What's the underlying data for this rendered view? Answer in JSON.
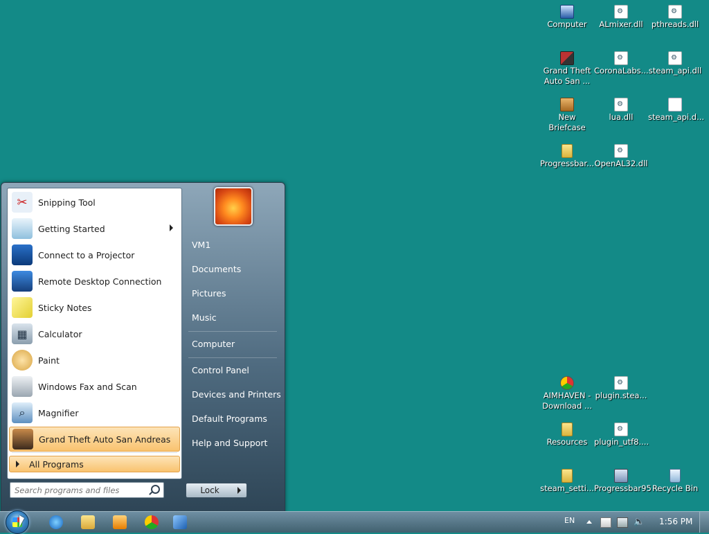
{
  "desktop": {
    "icons": [
      {
        "label": "Computer",
        "icon": "computer-icon"
      },
      {
        "label": "ALmixer.dll",
        "icon": "dll-file-icon"
      },
      {
        "label": "pthreads.dll",
        "icon": "dll-file-icon"
      },
      {
        "label": "Grand Theft Auto San ...",
        "icon": "gta-game-icon"
      },
      {
        "label": "CoronaLabs...",
        "icon": "dll-file-icon"
      },
      {
        "label": "steam_api.dll",
        "icon": "dll-file-icon"
      },
      {
        "label": "New Briefcase",
        "icon": "briefcase-icon"
      },
      {
        "label": "lua.dll",
        "icon": "dll-file-icon"
      },
      {
        "label": "steam_api.d...",
        "icon": "blank-file-icon"
      },
      {
        "label": "Progressbar...",
        "icon": "zip-folder-icon"
      },
      {
        "label": "OpenAL32.dll",
        "icon": "dll-file-icon"
      },
      {
        "label": "AIMHAVEN - Download ...",
        "icon": "chrome-shortcut-icon"
      },
      {
        "label": "plugin.stea...",
        "icon": "dll-file-icon"
      },
      {
        "label": "Resources",
        "icon": "zip-folder-icon"
      },
      {
        "label": "plugin_utf8....",
        "icon": "dll-file-icon"
      },
      {
        "label": "steam_setti...",
        "icon": "zip-folder-icon"
      },
      {
        "label": "Progressbar95",
        "icon": "exe-file-icon"
      },
      {
        "label": "Recycle Bin",
        "icon": "recycle-bin-icon"
      }
    ]
  },
  "start_menu": {
    "programs": [
      {
        "label": "Snipping Tool",
        "icon": "scissors-icon"
      },
      {
        "label": "Getting Started",
        "icon": "getting-started-icon",
        "submenu": true
      },
      {
        "label": "Connect to a Projector",
        "icon": "projector-icon"
      },
      {
        "label": "Remote Desktop Connection",
        "icon": "remote-desktop-icon"
      },
      {
        "label": "Sticky Notes",
        "icon": "sticky-notes-icon"
      },
      {
        "label": "Calculator",
        "icon": "calculator-icon"
      },
      {
        "label": "Paint",
        "icon": "paint-palette-icon"
      },
      {
        "label": "Windows Fax and Scan",
        "icon": "fax-icon"
      },
      {
        "label": "Magnifier",
        "icon": "magnifier-icon"
      },
      {
        "label": "Grand Theft Auto San Andreas",
        "icon": "gta-game-icon",
        "highlighted": true
      }
    ],
    "all_programs": "All Programs",
    "search": {
      "placeholder": "Search programs and files",
      "value": ""
    },
    "right_links": {
      "user": "VM1",
      "documents": "Documents",
      "pictures": "Pictures",
      "music": "Music",
      "computer": "Computer",
      "control_panel": "Control Panel",
      "devices": "Devices and Printers",
      "default_programs": "Default Programs",
      "help": "Help and Support"
    },
    "lock_label": "Lock"
  },
  "taskbar": {
    "pinned": [
      {
        "icon": "internet-explorer-icon"
      },
      {
        "icon": "file-explorer-icon"
      },
      {
        "icon": "media-player-icon"
      },
      {
        "icon": "chrome-icon"
      },
      {
        "icon": "visual-studio-icon"
      }
    ],
    "language": "EN",
    "clock": "1:56 PM"
  },
  "colors": {
    "desktop_bg": "#138a87",
    "highlight": "#f9c36f"
  }
}
